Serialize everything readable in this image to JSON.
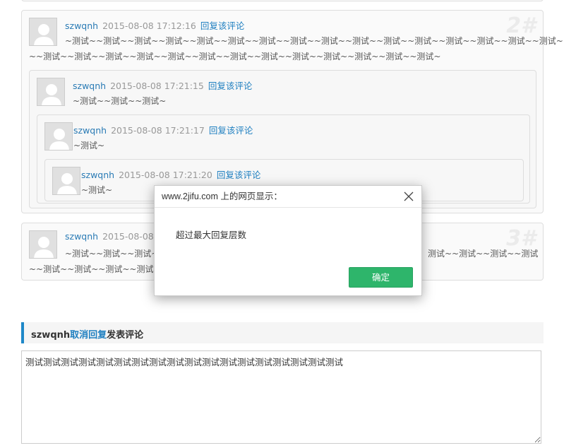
{
  "comments": {
    "c2": {
      "author": "szwqnh",
      "date": "2015-08-08 17:12:16",
      "reply_label": "回复该评论",
      "floor": "2#",
      "text_line1": "~测试~~测试~~测试~~测试~~测试~~测试~~测试~~测试~~测试~~测试~~测试~~测试~~测试~~测试~~测试~~测试~~测试",
      "text_line2": "~~测试~~测试~~测试~~测试~~测试~~测试~~测试~~测试~~测试~~测试~~测试~~测试~~测试~"
    },
    "r1": {
      "author": "szwqnh",
      "date": "2015-08-08 17:21:15",
      "reply_label": "回复该评论",
      "text": "~测试~~测试~~测试~"
    },
    "r2": {
      "author": "szwqnh",
      "date": "2015-08-08 17:21:17",
      "reply_label": "回复该评论",
      "text": "~测试~"
    },
    "r3": {
      "author": "szwqnh",
      "date": "2015-08-08 17:21:20",
      "reply_label": "回复该评论",
      "text": "~测试~"
    },
    "c3": {
      "author": "szwqnh",
      "date_visible": "2015-08-08 1",
      "floor": "3#",
      "text_line1_left": "~测试~~测试~~测试~",
      "text_line1_right": "测试~~测试~~测试~~测试",
      "text_line2": "~~测试~~测试~~测试~~测试~"
    }
  },
  "dialog": {
    "title": "www.2jifu.com 上的网页显示：",
    "message": "超过最大回复层数",
    "ok_label": "确定"
  },
  "form": {
    "user": "szwqnh",
    "cancel_label": "取消回复",
    "heading": "发表评论",
    "textarea_value": "测试测试测试测试测试测试测试测试测试测试测试测试测试测试测试测试测试测试"
  },
  "colors": {
    "link": "#1e7fc0",
    "ok_button": "#2eb56b",
    "accent_bar": "#1e88c8"
  }
}
